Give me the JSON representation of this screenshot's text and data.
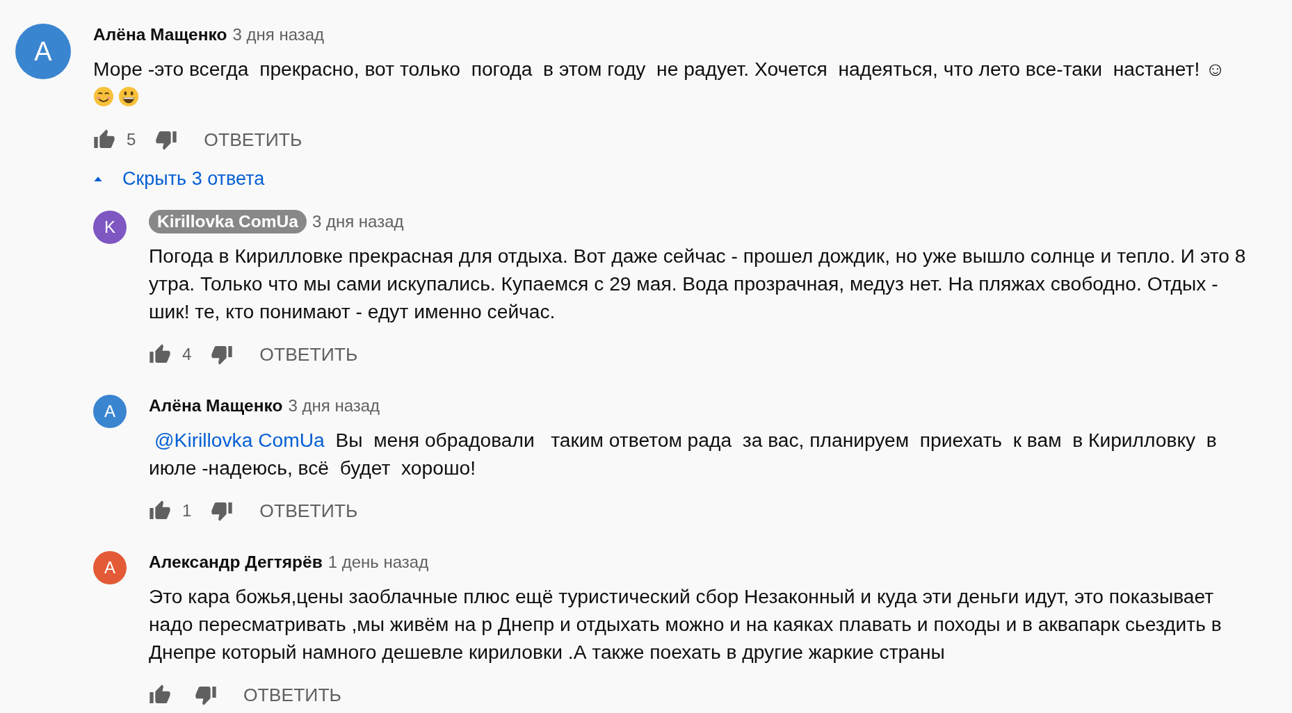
{
  "comment": {
    "author": "Алёна Мащенко",
    "author_highlighted": false,
    "avatar_letter": "А",
    "color": "#3a85d0",
    "time": "3 дня назад",
    "lines": [
      "Море -это всегда  прекрасно, вот только  погода  в этом году  не радует. Хочется  надеяться, что лето все-таки  настанет! ☺"
    ],
    "emojis": [
      {
        "kind": "smiling"
      },
      {
        "kind": "grinning"
      }
    ],
    "likes": "5",
    "reply_label": "ОТВЕТИТЬ",
    "replies_toggle": {
      "label": "Скрыть 3 ответа",
      "expanded": true
    },
    "replies": [
      {
        "author": "Kirillovka ComUa",
        "author_highlighted": true,
        "avatar_letter": "K",
        "color": "#7e57c2",
        "time": "3 дня назад",
        "lines": [
          "Погода в Кирилловке прекрасная для отдыха. Вот даже сейчас - прошел дождик, но уже вышло солнце и тепло. И это 8",
          "утра. Только что мы сами искупались. Купаемся с 29 мая. Вода прозрачная, медуз нет. На пляжах свободно. Отдых -",
          "шик! те, кто понимают - едут именно сейчас."
        ],
        "likes": "4",
        "reply_label": "ОТВЕТИТЬ"
      },
      {
        "author": "Алёна Мащенко",
        "author_highlighted": false,
        "avatar_letter": "А",
        "color": "#3a85d0",
        "time": "3 дня назад",
        "mention": "@Kirillovka ComUa",
        "lines": [
          "  Вы  меня обрадовали   таким ответом рада  за вас, планируем  приехать  к вам  в Кирилловку  в",
          "июле -надеюсь, всё  будет  хорошо!"
        ],
        "likes": "1",
        "reply_label": "ОТВЕТИТЬ"
      },
      {
        "author": "Александр Дегтярёв",
        "author_highlighted": false,
        "avatar_letter": "А",
        "color": "#e35b36",
        "time": "1 день назад",
        "lines": [
          "Это кара божья,цены заоблачные плюс ещё туристический сбор Незаконный и куда эти деньги идут, это показывает",
          "надо пересматривать ,мы живём на р Днепр и отдыхать можно и на каяках плавать и походы и в аквапарк сьездить в",
          "Днепре который намного дешевле кириловки .А также поехать в другие жаркие страны"
        ],
        "reply_label": "ОТВЕТИТЬ"
      }
    ]
  }
}
